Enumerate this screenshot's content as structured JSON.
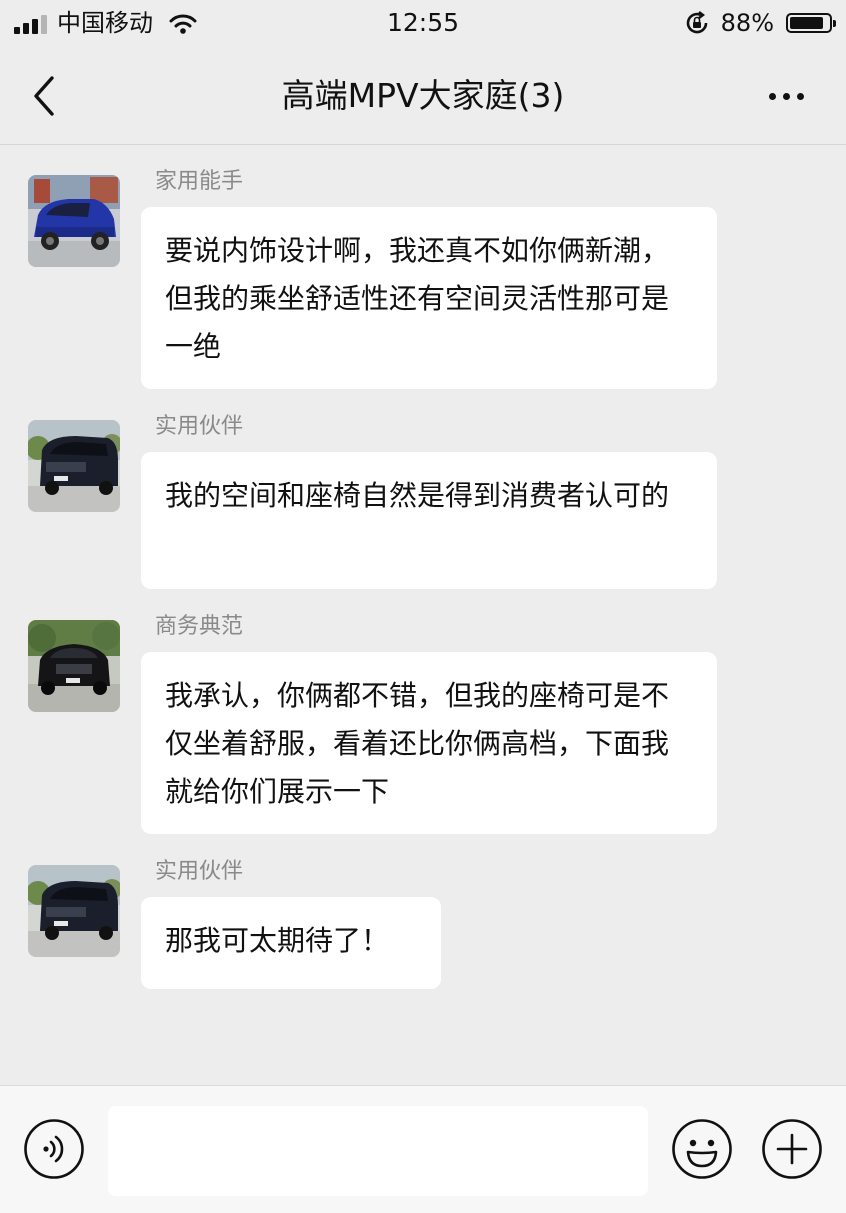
{
  "status_bar": {
    "carrier": "中国移动",
    "time": "12:55",
    "battery_percent": "88%",
    "battery_level": 0.88,
    "signal_bars": 3,
    "icons": [
      "signal-icon",
      "wifi-icon",
      "orientation-lock-icon",
      "battery-icon"
    ]
  },
  "nav": {
    "title": "高端MPV大家庭(3)",
    "back_icon": "chevron-left-icon",
    "more_icon": "more-dots-icon"
  },
  "messages": [
    {
      "sender": "家用能手",
      "text": "要说内饰设计啊，我还真不如你俩新潮，但我的乘坐舒适性还有空间灵活性那可是一绝",
      "avatar": "blue-mpv-avatar"
    },
    {
      "sender": "实用伙伴",
      "text": "我的空间和座椅自然是得到消费者认可的",
      "avatar": "dark-mpv-avatar"
    },
    {
      "sender": "商务典范",
      "text": "我承认，你俩都不错，但我的座椅可是不仅坐着舒服，看着还比你俩高档，下面我就给你们展示一下",
      "avatar": "black-suv-avatar"
    },
    {
      "sender": "实用伙伴",
      "text": "那我可太期待了！",
      "avatar": "dark-mpv-avatar"
    }
  ],
  "input_bar": {
    "placeholder": "",
    "value": "",
    "icons": [
      "voice-icon",
      "emoji-icon",
      "plus-icon"
    ]
  },
  "colors": {
    "background": "#ededed",
    "bubble": "#ffffff",
    "sender_name": "#8a8a8a",
    "input_bar": "#f7f7f7"
  }
}
